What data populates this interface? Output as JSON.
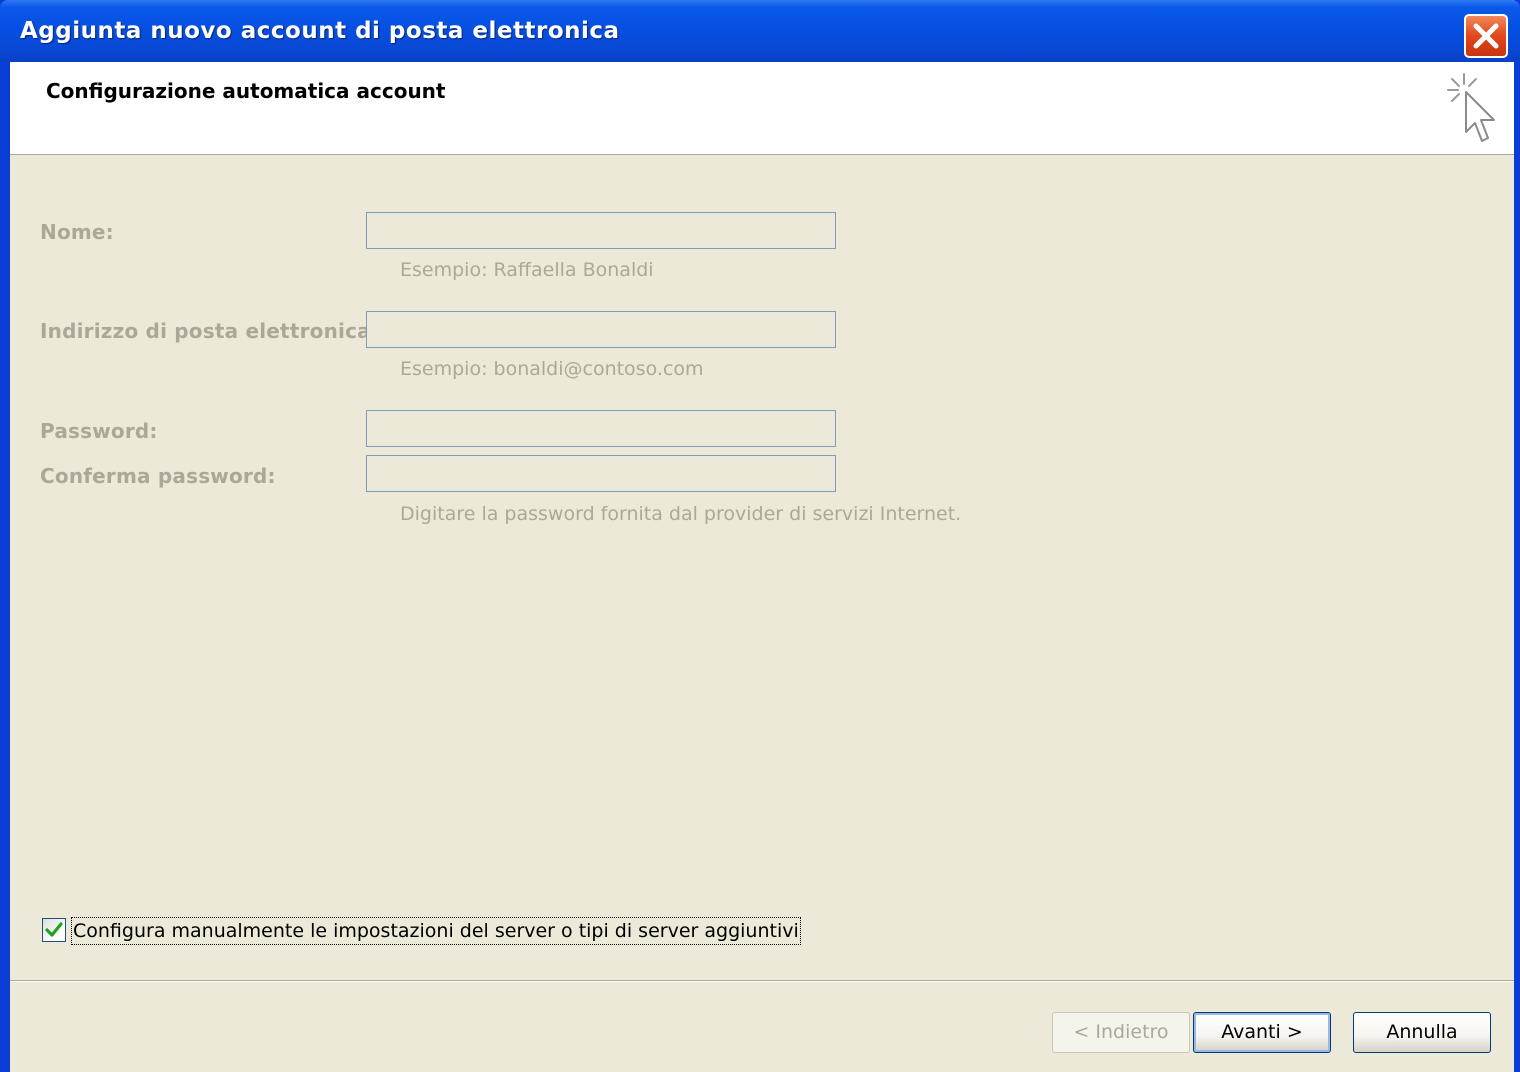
{
  "window": {
    "title": "Aggiunta nuovo account di posta elettronica",
    "close_icon": "close-icon",
    "titlebar_color": "#0a48d6",
    "close_color": "#e2461c"
  },
  "header": {
    "title": "Configurazione automatica account",
    "icon": "sparkle-cursor-icon"
  },
  "form": {
    "name": {
      "label": "Nome:",
      "value": "",
      "hint": "Esempio: Raffaella Bonaldi"
    },
    "email": {
      "label": "Indirizzo di posta elettronica:",
      "value": "",
      "hint": "Esempio: bonaldi@contoso.com"
    },
    "password": {
      "label": "Password:",
      "value": ""
    },
    "confirm_password": {
      "label": "Conferma password:",
      "value": "",
      "hint": "Digitare la password fornita dal provider di servizi Internet."
    },
    "disabled_color": "#aca899"
  },
  "manual_config": {
    "label": "Configura manualmente le impostazioni del server o tipi di server aggiuntivi",
    "checked": true,
    "check_icon": "checkmark-icon",
    "check_color": "#21a121"
  },
  "buttons": {
    "back": "< Indietro",
    "next": "Avanti >",
    "cancel": "Annulla"
  }
}
